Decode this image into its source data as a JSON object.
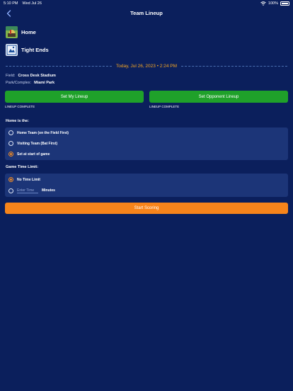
{
  "status_bar": {
    "time": "5:10 PM",
    "date": "Wed Jul 26",
    "battery": "100%"
  },
  "nav": {
    "title": "Team Lineup"
  },
  "teams": {
    "home": "Home",
    "away": "Tight Ends"
  },
  "game_date": "Today, Jul 26, 2023 • 2:24 PM",
  "field": {
    "label": "Field:",
    "value": "Cross Desk Stadium"
  },
  "park": {
    "label": "Park/Complex:",
    "value": "Miami Park"
  },
  "lineup": {
    "my_button": "Set My Lineup",
    "opponent_button": "Set Opponent Lineup",
    "my_status": "LINEUP COMPLETE",
    "opponent_status": "LINEUP COMPLETE"
  },
  "home_is": {
    "label": "Home is the:",
    "options": [
      "Home Team (on the Field First)",
      "Visiting Team (Bat First)",
      "Set at start of game"
    ],
    "selected": "Set at start of game"
  },
  "time_limit": {
    "label": "Game Time Limit:",
    "no_limit": "No Time Limit",
    "placeholder": "Enter Time",
    "unit": "Minutes",
    "selected": "No Time Limit"
  },
  "start_button": "Start Scoring",
  "colors": {
    "background": "#0b1f5c",
    "accent_green": "#1fa12a",
    "accent_orange": "#f7841b",
    "date_orange": "#f5a623"
  }
}
